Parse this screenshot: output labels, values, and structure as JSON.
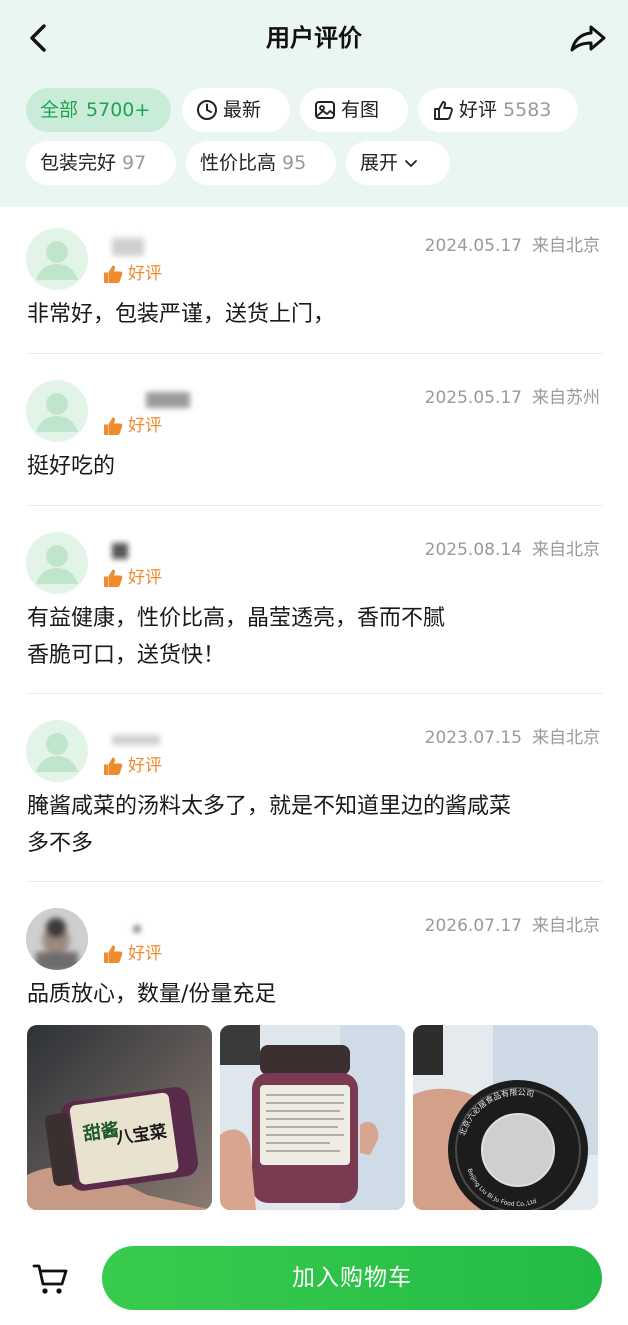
{
  "header": {
    "title": "用户评价"
  },
  "filters": [
    {
      "label": "全部",
      "count": "5700+"
    },
    {
      "label": "最新",
      "count": ""
    },
    {
      "label": "有图",
      "count": ""
    },
    {
      "label": "好评",
      "count": "5583"
    },
    {
      "label": "包装完好",
      "count": "97"
    },
    {
      "label": "性价比高",
      "count": "95"
    },
    {
      "label": "展开",
      "count": ""
    }
  ],
  "reviews": [
    {
      "rating": "好评",
      "date": "2024.05.17",
      "location": "来自北京",
      "lines": [
        "非常好，包装严谨，送货上门，"
      ]
    },
    {
      "rating": "好评",
      "date": "2025.05.17",
      "location": "来自苏州",
      "lines": [
        "挺好吃的"
      ]
    },
    {
      "rating": "好评",
      "date": "2025.08.14",
      "location": "来自北京",
      "lines": [
        "有益健康，性价比高，晶莹透亮，香而不腻",
        "香脆可口，送货快！"
      ]
    },
    {
      "rating": "好评",
      "date": "2023.07.15",
      "location": "来自北京",
      "lines": [
        "腌酱咸菜的汤料太多了，就是不知道里边的酱咸菜",
        "多不多"
      ]
    },
    {
      "rating": "好评",
      "date": "2026.07.17",
      "location": "来自北京",
      "lines": [
        "品质放心，数量/份量充足"
      ]
    }
  ],
  "photo_texts": {
    "jar_label_top": "甜酱",
    "jar_label_main": "八宝菜",
    "lid_text": "北京六必居食品有限公司",
    "lid_text_en": "Beijing Liu Bi Ju Food Co.,Ltd"
  },
  "bottom_bar": {
    "add_to_cart": "加入购物车"
  },
  "colors": {
    "accent": "#24bb45",
    "badge": "#f08a2c",
    "header_bg": "#eaf6f2"
  }
}
